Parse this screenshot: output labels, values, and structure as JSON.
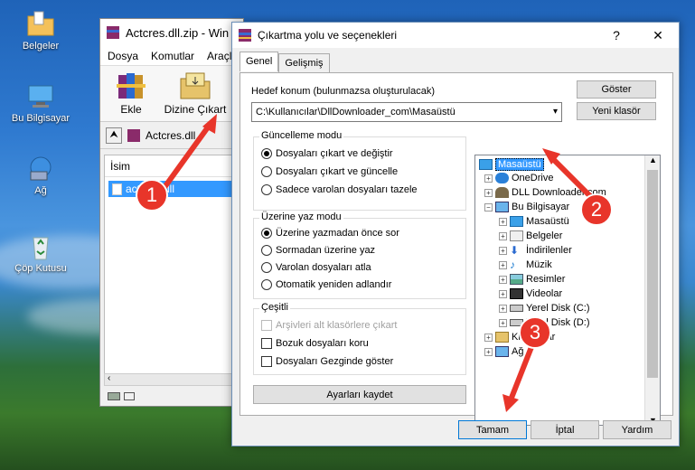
{
  "desktop": {
    "icons": [
      {
        "label": "Belgeler"
      },
      {
        "label": "Bu Bilgisayar"
      },
      {
        "label": "Ağ"
      },
      {
        "label": "Çöp Kutusu"
      }
    ]
  },
  "winrar": {
    "title": "Actcres.dll.zip - Win",
    "menu": [
      "Dosya",
      "Komutlar",
      "Araçlar"
    ],
    "toolbar": {
      "extract_label": "Ekle",
      "extract_to_label": "Dizine Çıkart"
    },
    "address": "Actcres.dll.",
    "column_name": "İsim",
    "file_row": "actcres.dll"
  },
  "dialog": {
    "title": "Çıkartma yolu ve seçenekleri",
    "help": "?",
    "close": "✕",
    "tabs": [
      "Genel",
      "Gelişmiş"
    ],
    "dest_label": "Hedef konum (bulunmazsa oluşturulacak)",
    "dest_value": "C:\\Kullanıcılar\\DllDownloader_com\\Masaüstü",
    "show_button": "Göster",
    "new_folder_button": "Yeni klasör",
    "update_group": {
      "title": "Güncelleme modu",
      "options": [
        "Dosyaları çıkart ve değiştir",
        "Dosyaları çıkart ve güncelle",
        "Sadece varolan dosyaları tazele"
      ],
      "selected": 0
    },
    "overwrite_group": {
      "title": "Üzerine yaz modu",
      "options": [
        "Üzerine yazmadan önce sor",
        "Sormadan üzerine yaz",
        "Varolan dosyaları atla",
        "Otomatik yeniden adlandır"
      ],
      "selected": 0
    },
    "misc_group": {
      "title": "Çeşitli",
      "options": [
        "Arşivleri alt klasörlere çıkart",
        "Bozuk dosyaları koru",
        "Dosyaları Gezginde göster"
      ]
    },
    "save_button": "Ayarları kaydet",
    "tree": {
      "root": "Masaüstü",
      "items": [
        "OneDrive",
        "DLL Downloader.com",
        "Bu Bilgisayar",
        "Masaüstü",
        "Belgeler",
        "İndirilenler",
        "Müzik",
        "Resimler",
        "Videolar",
        "Yerel Disk (C:)",
        "Yerel Disk (D:)",
        "Kitaplıklar",
        "Ağ"
      ]
    },
    "ok_button": "Tamam",
    "cancel_button": "İptal",
    "help_button": "Yardım"
  },
  "annotations": [
    "1",
    "2",
    "3"
  ],
  "colors": {
    "accent": "#e8352a",
    "selection": "#3399ff"
  }
}
